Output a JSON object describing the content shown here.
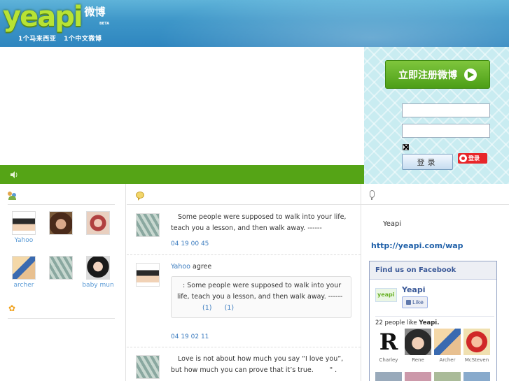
{
  "header": {
    "logo_word": "yeapi",
    "logo_cn": "微博",
    "beta": "BETA",
    "slogan": "1个马来西亚   1个中文微博"
  },
  "login": {
    "register_label": "立即注册微博",
    "login_label": "登录",
    "weibo_login_label": "登录"
  },
  "left": {
    "users": [
      {
        "name": "Yahoo"
      },
      {
        "name": ""
      },
      {
        "name": ""
      },
      {
        "name": "archer"
      },
      {
        "name": ""
      },
      {
        "name": "baby mun"
      }
    ]
  },
  "feed": [
    {
      "text": "Some people were supposed to walk into your life, teach you a lesson, and then walk away. ------",
      "time": "04 19   00 45"
    },
    {
      "user": "Yahoo",
      "action": "agree",
      "quote": ": Some people were supposed to walk into your life, teach you a lesson, and then walk away. ------",
      "count_a": "(1)",
      "count_b": "(1)",
      "time": "04 19   02 11"
    },
    {
      "text": "Love is not about how much you say “I love you”, but how much you can prove that it’s true.",
      "trailing": "\" ."
    }
  ],
  "right": {
    "yeapi_label": "Yeapi",
    "wap_link": "http://yeapi.com/wap",
    "facebook": {
      "title": "Find us on Facebook",
      "page_name": "Yeapi",
      "page_logo": "yeapi",
      "like_label": "Like",
      "likes_count": "22",
      "likes_text": "people like",
      "likes_page": "Yeapi.",
      "fans": [
        {
          "name": "Charley",
          "letter": "R"
        },
        {
          "name": "Rene"
        },
        {
          "name": "Archer"
        },
        {
          "name": "McSteven"
        }
      ]
    }
  },
  "colors": {
    "green_bar": "#55a416",
    "header_blue": "#3d96c8",
    "login_panel": "#c9ecf1",
    "facebook_blue": "#3b5998",
    "link_blue": "#1e5fa8"
  }
}
